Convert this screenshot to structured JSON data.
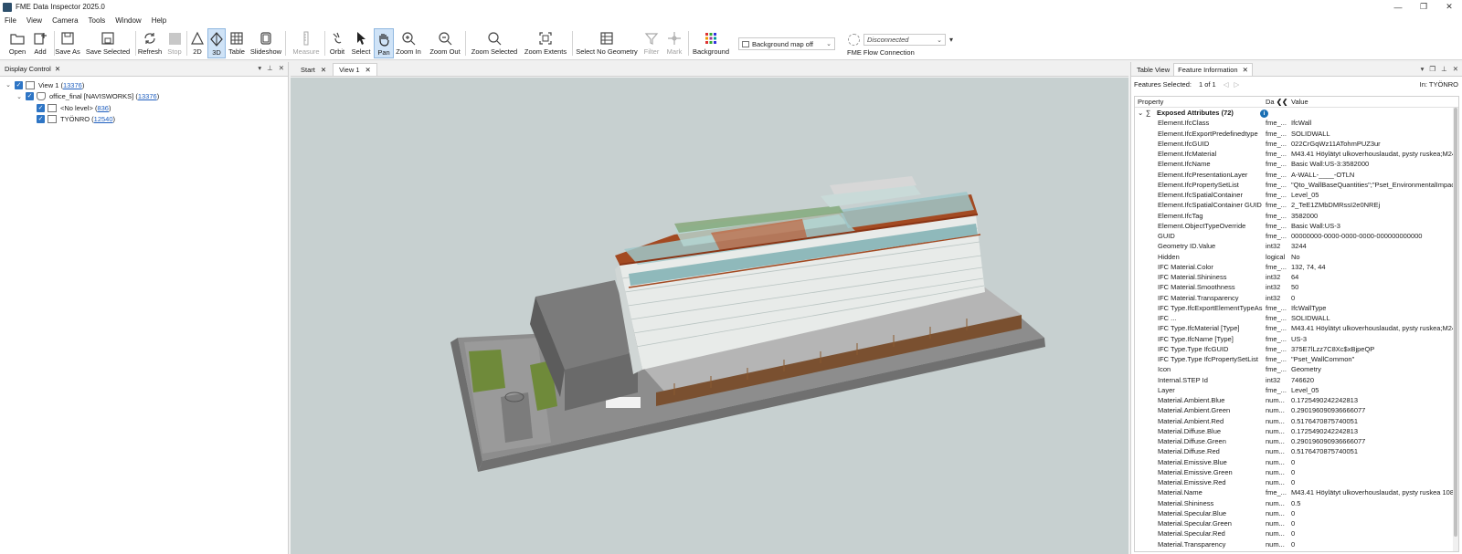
{
  "window": {
    "title": "FME Data Inspector 2025.0",
    "minimize": "—",
    "maximize": "❐",
    "close": "✕"
  },
  "menu": [
    "File",
    "View",
    "Camera",
    "Tools",
    "Window",
    "Help"
  ],
  "toolbar": {
    "open": "Open",
    "add": "Add",
    "save_as": "Save As",
    "save_selected": "Save Selected",
    "refresh": "Refresh",
    "stop": "Stop",
    "two_d": "2D",
    "three_d": "3D",
    "table": "Table",
    "slideshow": "Slideshow",
    "measure": "Measure",
    "orbit": "Orbit",
    "select": "Select",
    "pan": "Pan",
    "zoom_in": "Zoom In",
    "zoom_out": "Zoom Out",
    "zoom_selected": "Zoom Selected",
    "zoom_extents": "Zoom Extents",
    "select_no_geometry": "Select No Geometry",
    "filter": "Filter",
    "mark": "Mark",
    "background": "Background",
    "background_map": "Background map off",
    "connection_status": "Disconnected",
    "fme_flow_connection": "FME Flow Connection"
  },
  "display_control": {
    "title": "Display Control",
    "close": "✕",
    "tree": [
      {
        "label": "View 1 (",
        "count": "13376",
        "suffix": ")"
      },
      {
        "label": "office_final [NAVISWORKS] (",
        "count": "13376",
        "suffix": ")"
      },
      {
        "label": "<No level> (",
        "count": "836",
        "suffix": ")"
      },
      {
        "label": "TYÖNRO (",
        "count": "12540",
        "suffix": ")"
      }
    ]
  },
  "center_tabs": {
    "start": "Start",
    "view1": "View 1",
    "close": "✕"
  },
  "right_panel": {
    "tabs": {
      "table_view": "Table View",
      "feature_info": "Feature Information",
      "close": "✕"
    },
    "features_selected_label": "Features Selected:",
    "features_selected_value": "1 of 1",
    "in_label": "In:",
    "in_value": "TYÖNRO",
    "columns": {
      "property": "Property",
      "datatype": "Da",
      "collapse": "❮❮",
      "value": "Value"
    },
    "group": "Exposed Attributes (72)",
    "rows": [
      [
        "Element.IfcClass",
        "fme_...",
        "IfcWall"
      ],
      [
        "Element.IfcExportPredefinedtype",
        "fme_...",
        "SOLIDWALL"
      ],
      [
        "Element.IfcGUID",
        "fme_...",
        "022CrGqWz11ATohmPUZ3ur"
      ],
      [
        "Element.IfcMaterial",
        "fme_...",
        "M43.41 Höylätyt ulkoverhouslaudat, pysty ruskea;M24"
      ],
      [
        "Element.IfcName",
        "fme_...",
        "Basic Wall:US-3:3582000"
      ],
      [
        "Element.IfcPresentationLayer",
        "fme_...",
        "A-WALL-____-OTLN"
      ],
      [
        "Element.IfcPropertySetList",
        "fme_...",
        "\"Qto_WallBaseQuantities\";\"Pset_EnvironmentalImpac"
      ],
      [
        "Element.IfcSpatialContainer",
        "fme_...",
        "Level_05"
      ],
      [
        "Element.IfcSpatialContainer GUID",
        "fme_...",
        "2_TeE1ZMbDMRssI2e0NREj"
      ],
      [
        "Element.IfcTag",
        "fme_...",
        "3582000"
      ],
      [
        "Element.ObjectTypeOverride",
        "fme_...",
        "Basic Wall:US-3"
      ],
      [
        "GUID",
        "fme_...",
        "00000000-0000-0000-0000-000000000000"
      ],
      [
        "Geometry ID.Value",
        "int32",
        "3244"
      ],
      [
        "Hidden",
        "logical",
        "No"
      ],
      [
        "IFC Material.Color",
        "fme_...",
        "132, 74, 44"
      ],
      [
        "IFC Material.Shininess",
        "int32",
        "64"
      ],
      [
        "IFC Material.Smoothness",
        "int32",
        "50"
      ],
      [
        "IFC Material.Transparency",
        "int32",
        "0"
      ],
      [
        "IFC Type.IfcExportElementTypeAs",
        "fme_...",
        "IfcWallType"
      ],
      [
        "IFC ...",
        "fme_...",
        "SOLIDWALL"
      ],
      [
        "IFC Type.IfcMaterial [Type]",
        "fme_...",
        "M43.41 Höylätyt ulkoverhouslaudat, pysty ruskea;M24"
      ],
      [
        "IFC Type.IfcName [Type]",
        "fme_...",
        "US-3"
      ],
      [
        "IFC Type.Type IfcGUID",
        "fme_...",
        "375E7lLzz7C8Xc$xBjpeQP"
      ],
      [
        "IFC Type.Type IfcPropertySetList",
        "fme_...",
        "\"Pset_WallCommon\""
      ],
      [
        "Icon",
        "fme_...",
        "Geometry"
      ],
      [
        "Internal.STEP Id",
        "int32",
        "746620"
      ],
      [
        "Layer",
        "fme_...",
        "Level_05"
      ],
      [
        "Material.Ambient.Blue",
        "num...",
        "0.1725490242242813"
      ],
      [
        "Material.Ambient.Green",
        "num...",
        "0.290196090936666077"
      ],
      [
        "Material.Ambient.Red",
        "num...",
        "0.5176470875740051"
      ],
      [
        "Material.Diffuse.Blue",
        "num...",
        "0.1725490242242813"
      ],
      [
        "Material.Diffuse.Green",
        "num...",
        "0.290196090936666077"
      ],
      [
        "Material.Diffuse.Red",
        "num...",
        "0.5176470875740051"
      ],
      [
        "Material.Emissive.Blue",
        "num...",
        "0"
      ],
      [
        "Material.Emissive.Green",
        "num...",
        "0"
      ],
      [
        "Material.Emissive.Red",
        "num...",
        "0"
      ],
      [
        "Material.Name",
        "fme_...",
        "M43.41 Höylätyt ulkoverhouslaudat, pysty ruskea 108"
      ],
      [
        "Material.Shininess",
        "num...",
        "0.5"
      ],
      [
        "Material.Specular.Blue",
        "num...",
        "0"
      ],
      [
        "Material.Specular.Green",
        "num...",
        "0"
      ],
      [
        "Material.Specular.Red",
        "num...",
        "0"
      ],
      [
        "Material.Transparency",
        "num...",
        "0"
      ]
    ]
  },
  "colors": {
    "accent": "#2e75c5",
    "viewport_bg": "#c7d0d0",
    "roof": "#a34a22",
    "glass": "#9fc7c9"
  }
}
